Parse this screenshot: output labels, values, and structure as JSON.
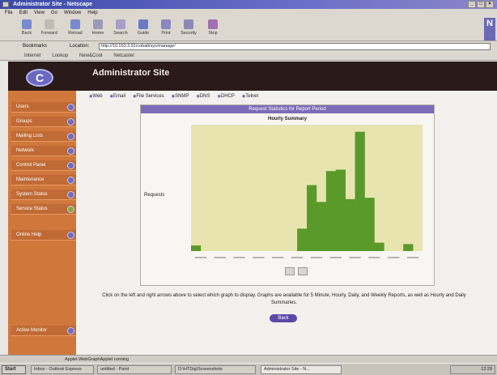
{
  "window": {
    "title": "Administrator Site - Netscape"
  },
  "menubar": [
    "File",
    "Edit",
    "View",
    "Go",
    "Window",
    "Help"
  ],
  "toolbar": [
    {
      "label": "Back",
      "icon": "back-arrow-icon"
    },
    {
      "label": "Forward",
      "icon": "forward-arrow-icon"
    },
    {
      "label": "Reload",
      "icon": "reload-icon"
    },
    {
      "label": "Home",
      "icon": "home-icon"
    },
    {
      "label": "Search",
      "icon": "search-icon"
    },
    {
      "label": "Guide",
      "icon": "guide-icon"
    },
    {
      "label": "Print",
      "icon": "print-icon"
    },
    {
      "label": "Security",
      "icon": "lock-icon"
    },
    {
      "label": "Stop",
      "icon": "stop-icon"
    }
  ],
  "location": {
    "bookmarks_label": "Bookmarks",
    "label": "Location:",
    "url": "http://10.163.3.91/cobalt/sys/manage/"
  },
  "personal_toolbar": [
    "Internet",
    "Lookup",
    "New&Cool",
    "Netcaster"
  ],
  "site": {
    "logo": "C",
    "title": "Administrator Site"
  },
  "sidebar": {
    "items": [
      "Users",
      "Groups",
      "Mailing Lists",
      "Network",
      "Control Panel",
      "Maintenance",
      "System Status",
      "Service Status"
    ],
    "help_item": "Online Help",
    "bottom_item": "Active Monitor"
  },
  "nav_tabs": [
    "Web",
    "Email",
    "File Services",
    "SNMP",
    "DNS",
    "DHCP",
    "Telnet"
  ],
  "chart": {
    "panel_header": "Request Statistics for Report Period",
    "back_button": "Back"
  },
  "chart_data": {
    "type": "bar",
    "title": "Hourly Summary",
    "ylabel": "Requests",
    "categories": [
      "h1",
      "h2",
      "h3",
      "h4",
      "h5",
      "h6",
      "h7",
      "h8",
      "h9",
      "h10",
      "h11",
      "h12",
      "h13",
      "h14",
      "h15",
      "h16",
      "h17",
      "h18",
      "h19",
      "h20",
      "h21",
      "h22",
      "h23",
      "h24"
    ],
    "values": [
      4,
      0,
      0,
      0,
      0,
      0,
      0,
      0,
      0,
      0,
      0,
      16,
      47,
      35,
      57,
      58,
      37,
      85,
      38,
      6,
      0,
      0,
      5,
      0
    ],
    "ylim": [
      0,
      90
    ]
  },
  "instructions": "Click on the left and right arrows above to select which graph to display. Graphs are available for 5 Minute, Hourly, Daily, and Weekly Reports, as well as Hourly and Daily Summaries.",
  "status_text": "Applet WebGraphApplet running",
  "taskbar": {
    "start": "Start",
    "tasks": [
      "Inbox - Outlook Express",
      "untitled - Paint",
      "D:\\HTDig\\Screenshots",
      "Administrator Site - N..."
    ],
    "clock": "12:29"
  },
  "colors": {
    "sidebar": "#d0783c",
    "bar": "#5a9a2a",
    "plot_bg": "#e8e4b0",
    "accent": "#6a6ab4"
  }
}
